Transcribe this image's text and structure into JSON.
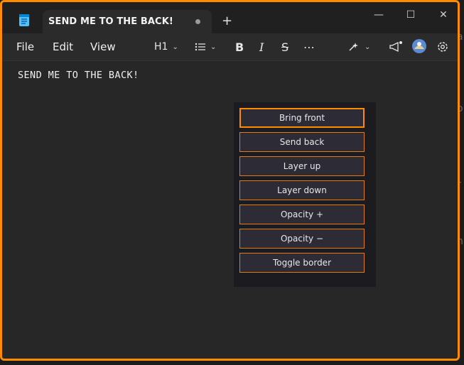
{
  "tab": {
    "title": "SEND ME TO THE BACK!"
  },
  "menu": {
    "file": "File",
    "edit": "Edit",
    "view": "View"
  },
  "toolbar": {
    "heading": "H1"
  },
  "editor": {
    "text": "SEND ME TO THE BACK!"
  },
  "panel": {
    "buttons": [
      "Bring front",
      "Send back",
      "Layer up",
      "Layer down",
      "Opacity +",
      "Opacity −",
      "Toggle border"
    ]
  },
  "colors": {
    "accent": "#ff8c00",
    "panel_bg": "#1c1c20",
    "button_bg": "#2c2b36"
  },
  "icons": [
    "notepad-icon",
    "list-icon",
    "bold-icon",
    "italic-icon",
    "strikethrough-icon",
    "more-icon",
    "copilot-icon",
    "megaphone-icon",
    "avatar",
    "gear-icon"
  ]
}
